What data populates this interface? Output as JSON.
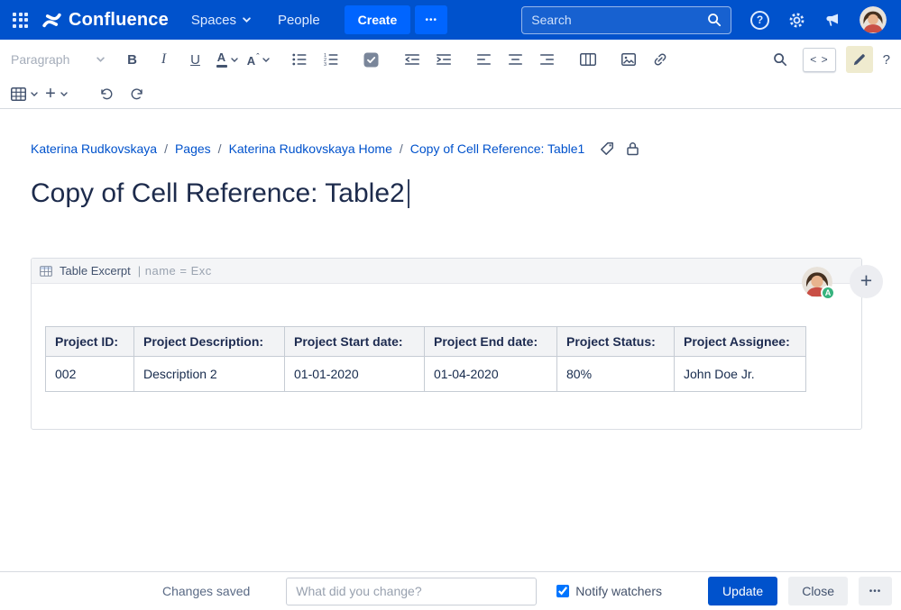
{
  "colors": {
    "header_bg": "#0052CC",
    "create_button_bg": "#0065FF",
    "link": "#0052CC",
    "text_primary": "#172B4D",
    "toolbar_icon": "#42526E",
    "table_header_bg": "#F2F3F5",
    "macro_header_bg": "#F4F5F7",
    "update_button_bg": "#0052CC",
    "presence_badge": "#36B37E",
    "pen_highlight_bg": "#EFEBCF"
  },
  "header": {
    "product_name": "Confluence",
    "spaces_label": "Spaces",
    "people_label": "People",
    "create_label": "Create",
    "more_label": "•••",
    "search_placeholder": "Search",
    "help_label": "?"
  },
  "toolbar": {
    "paragraph_label": "Paragraph",
    "bold_label": "B",
    "italic_label": "I",
    "underline_label": "U",
    "text_color_label": "A",
    "more_format_label": "A",
    "code_label": "< >",
    "help_label": "?",
    "insert_plus_label": "+"
  },
  "breadcrumb": {
    "separator": "/",
    "items": [
      "Katerina Rudkovskaya",
      "Pages",
      "Katerina Rudkovskaya Home",
      "Copy of Cell Reference: Table1"
    ]
  },
  "page": {
    "title": "Copy of Cell Reference: Table2",
    "presence_initial": "A",
    "invite_plus_label": "+"
  },
  "macro": {
    "name": "Table Excerpt",
    "parameters": "| name = Exc"
  },
  "content_table": {
    "headers": [
      "Project ID:",
      "Project Description:",
      "Project Start date:",
      "Project End date:",
      "Project Status:",
      "Project Assignee:"
    ],
    "rows": [
      [
        "002",
        "Description 2",
        "01-01-2020",
        "01-04-2020",
        "80%",
        "John Doe Jr."
      ]
    ]
  },
  "footer": {
    "status_text": "Changes saved",
    "comment_placeholder": "What did you change?",
    "notify_watchers_label": "Notify watchers",
    "notify_checked": "checked",
    "update_label": "Update",
    "close_label": "Close",
    "more_label": "•••"
  }
}
